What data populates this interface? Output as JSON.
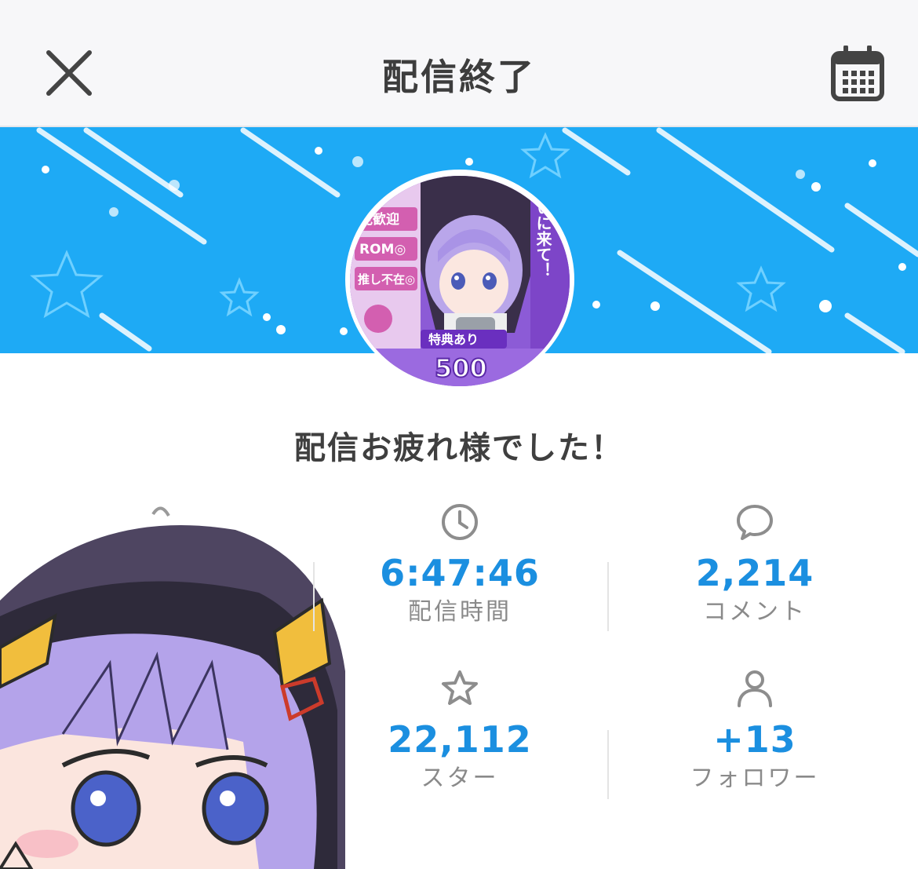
{
  "header": {
    "title": "配信終了",
    "close_icon": "close-icon",
    "calendar_icon": "calendar-icon"
  },
  "message": "配信お疲れ様でした！",
  "stats": {
    "duration": {
      "value": "6:47:46",
      "label": "配信時間",
      "icon": "clock-icon"
    },
    "comments": {
      "value": "2,214",
      "label": "コメント",
      "icon": "speech-bubble-icon"
    },
    "stars": {
      "value": "22,112",
      "label": "スター",
      "icon": "star-icon"
    },
    "followers": {
      "value": "+13",
      "label": "フォロワー",
      "icon": "person-icon"
    }
  },
  "avatar_text": {
    "line1": "見歓迎",
    "line2": "ROM◎",
    "line3": "推し不在◎",
    "badge": "特典あり",
    "number": "500",
    "vertical": "いに来て！"
  },
  "colors": {
    "accent": "#1b8fe0",
    "banner": "#1eaaf5",
    "header_bg": "#f7f7f9",
    "text_dark": "#3d3d3d",
    "text_muted": "#8a8a8a"
  }
}
